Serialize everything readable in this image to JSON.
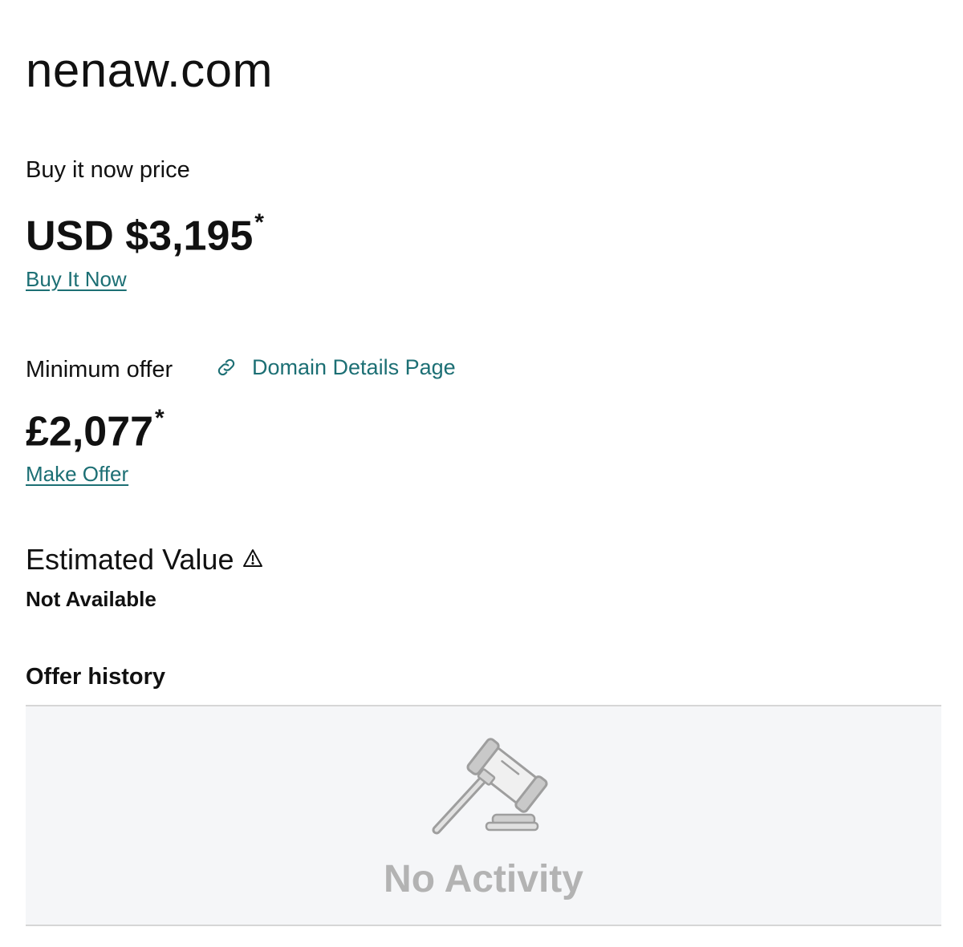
{
  "domain": {
    "name": "nenaw.com"
  },
  "buy_now": {
    "label": "Buy it now price",
    "price": "USD $3,195",
    "asterisk": "*",
    "link_label": "Buy It Now"
  },
  "minimum_offer": {
    "label": "Minimum offer",
    "details_link_label": "Domain Details Page",
    "details_icon": "link-icon",
    "price": "£2,077",
    "asterisk": "*",
    "link_label": "Make Offer"
  },
  "estimated_value": {
    "title": "Estimated Value",
    "icon": "warning-icon",
    "value": "Not Available"
  },
  "offer_history": {
    "title": "Offer history",
    "empty_icon": "gavel-icon",
    "empty_text": "No Activity"
  },
  "colors": {
    "link": "#1c6f74",
    "text": "#111111",
    "empty_text": "#b3b3b3",
    "panel_bg": "#f5f6f8"
  }
}
